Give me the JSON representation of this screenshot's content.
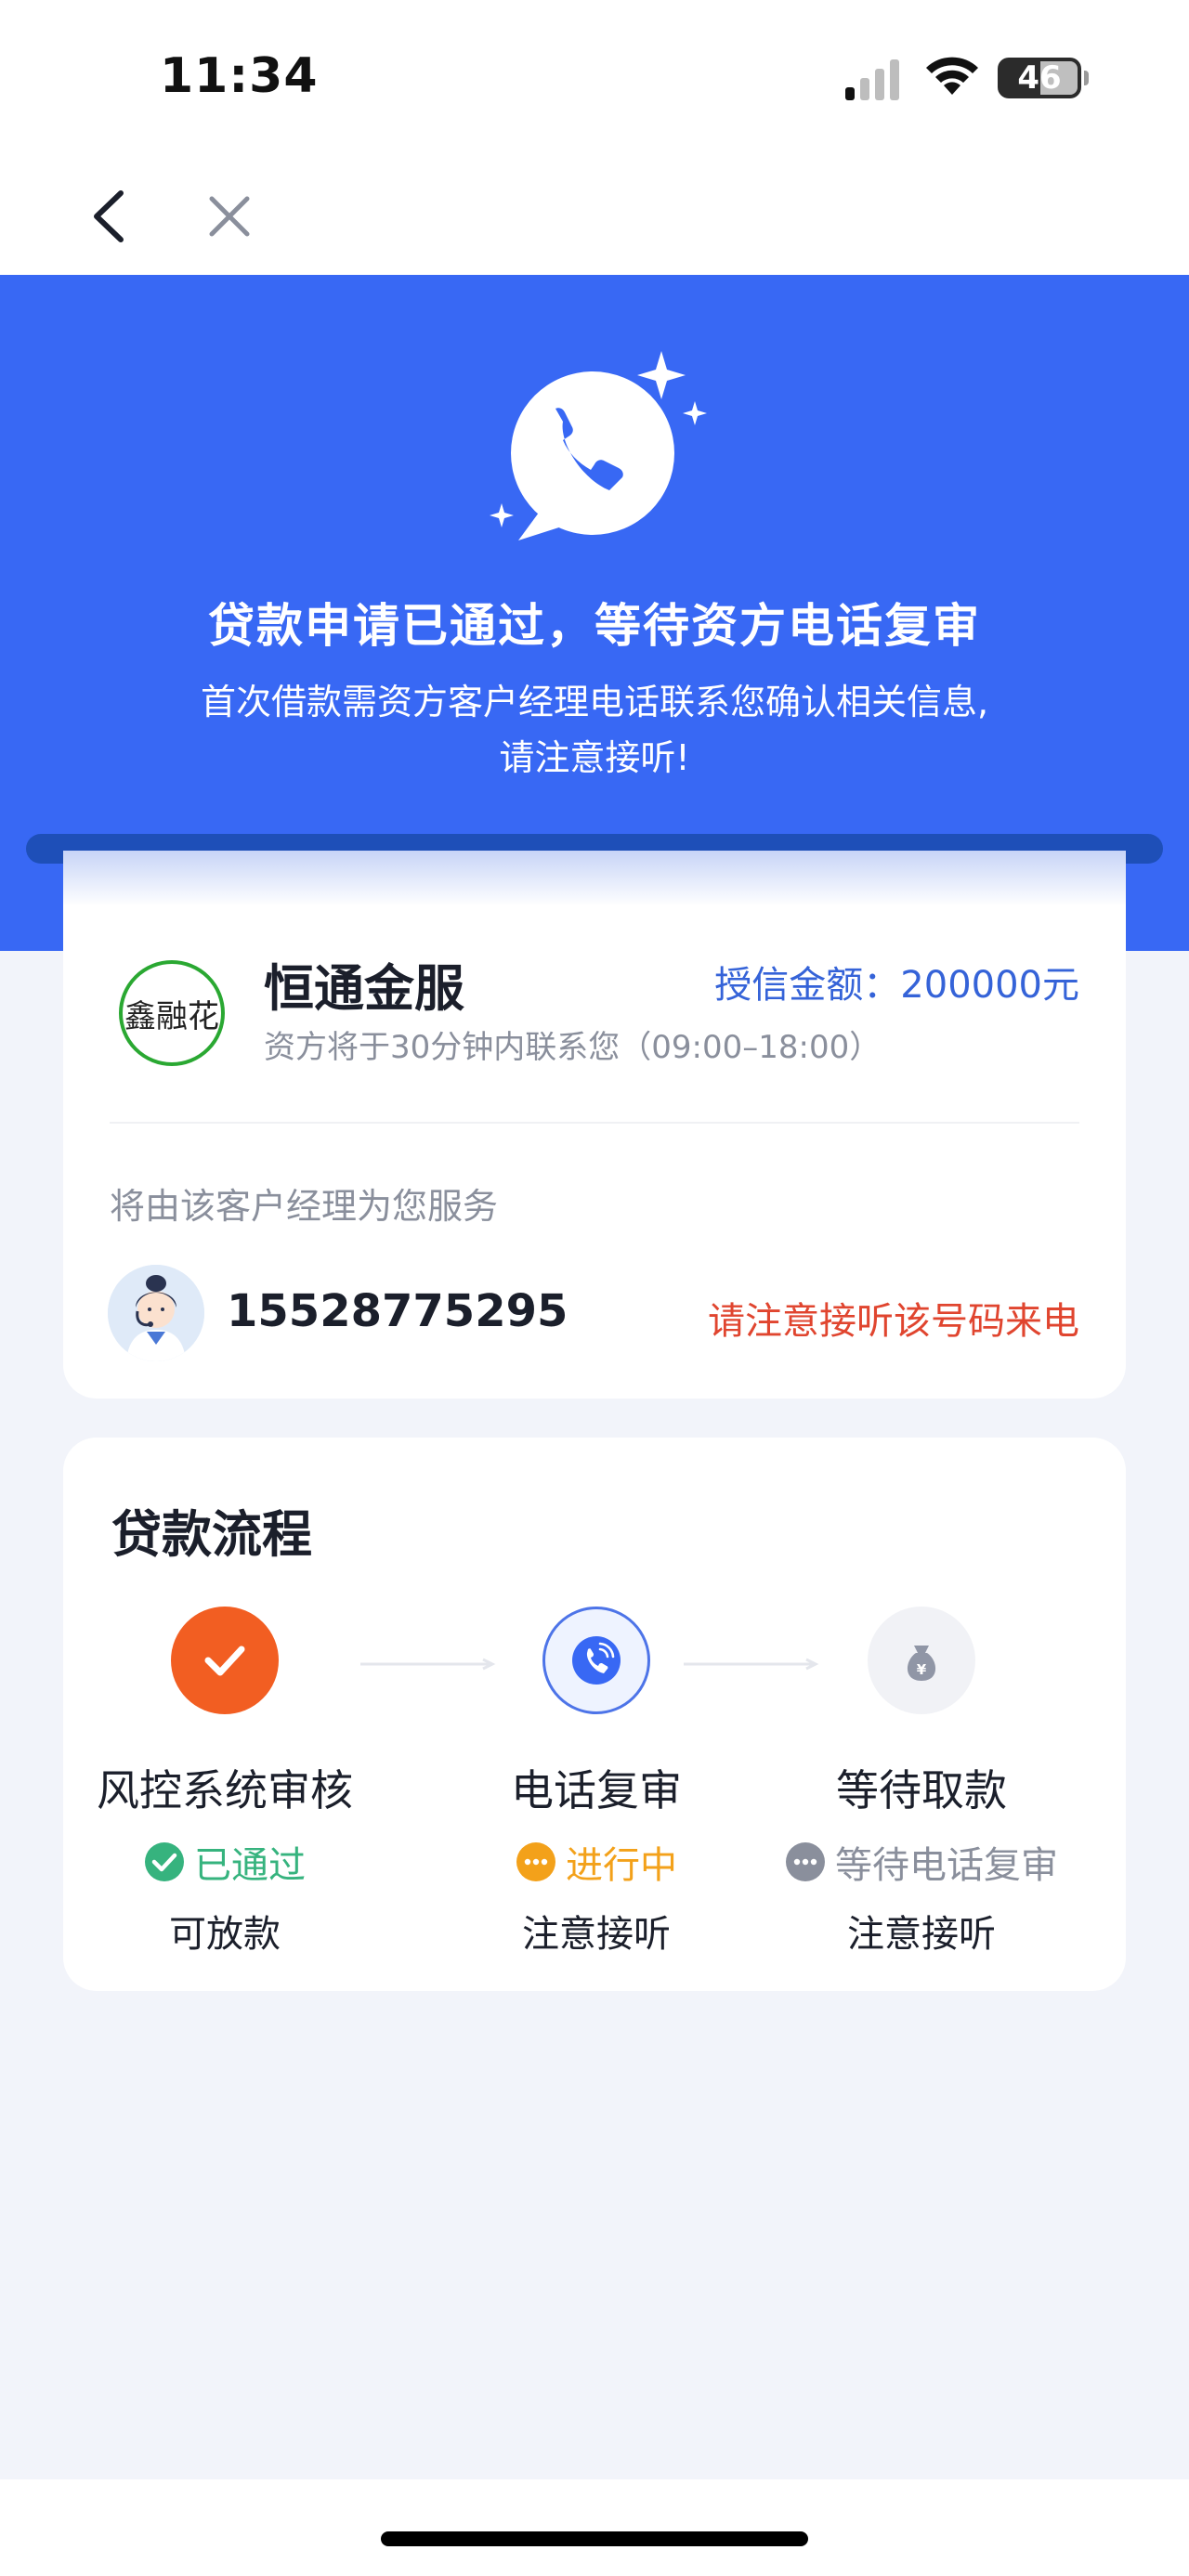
{
  "status_bar": {
    "time": "11:34",
    "battery": "46"
  },
  "hero": {
    "title": "贷款申请已通过，等待资方电话复审",
    "subtitle": "首次借款需资方客户经理电话联系您确认相关信息, 请注意接听!"
  },
  "company": {
    "logo_text": "鑫融花",
    "name": "恒通金服",
    "credit_amount": "授信金额：200000元",
    "contact_desc": "资方将于30分钟内联系您（09:00–18:00）"
  },
  "manager": {
    "label": "将由该客户经理为您服务",
    "phone": "15528775295",
    "notice": "请注意接听该号码来电"
  },
  "flow": {
    "title": "贷款流程",
    "steps": [
      {
        "name": "风控系统审核",
        "status": "已通过",
        "note": "可放款",
        "state": "done",
        "icon": "check-icon"
      },
      {
        "name": "电话复审",
        "status": "进行中",
        "note": "注意接听",
        "state": "active",
        "icon": "phone-call-icon"
      },
      {
        "name": "等待取款",
        "status": "等待电话复审",
        "note": "注意接听",
        "state": "waiting",
        "icon": "money-bag-icon"
      }
    ]
  },
  "colors": {
    "hero_blue": "#3868f4",
    "accent_orange": "#f25e22",
    "success_green": "#36b37e",
    "warning_orange": "#f3a11a",
    "notice_red": "#e0452f",
    "link_blue": "#3563d8"
  }
}
